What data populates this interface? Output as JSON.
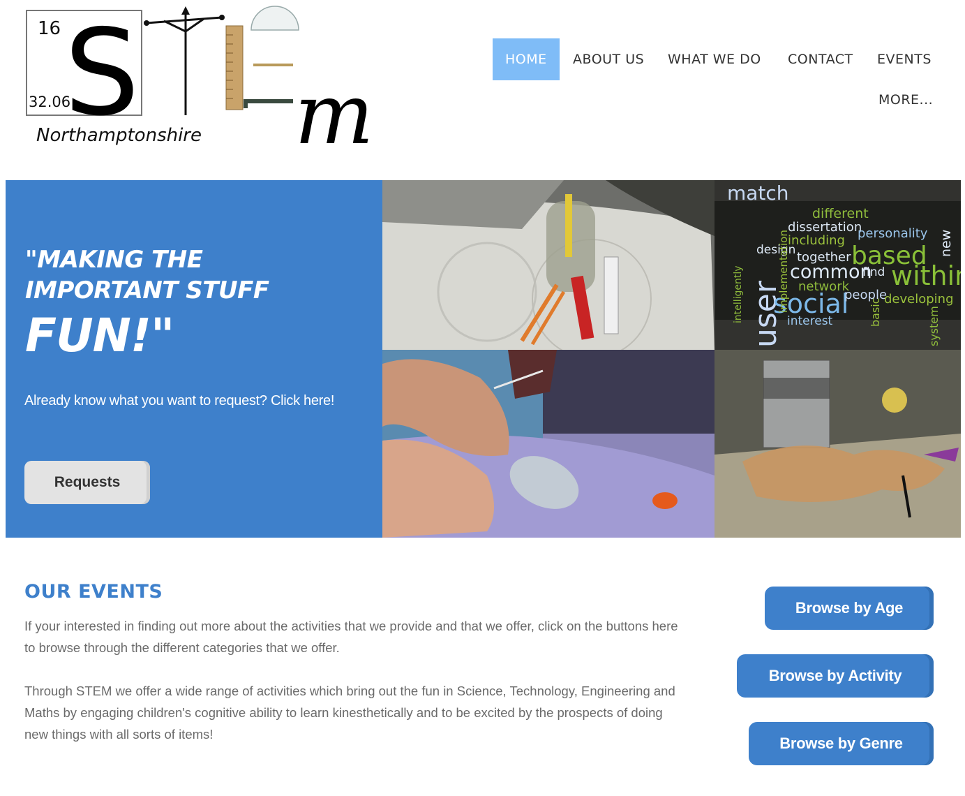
{
  "logo": {
    "atomic_number": "16",
    "symbol": "S",
    "atomic_mass": "32.06",
    "tagline": "Northamptonshire",
    "letter": "m"
  },
  "nav": {
    "items": [
      {
        "label": "HOME",
        "active": true
      },
      {
        "label": "ABOUT US"
      },
      {
        "label": "WHAT WE DO"
      },
      {
        "label": "CONTACT"
      },
      {
        "label": "EVENTS"
      },
      {
        "label": "MORE..."
      }
    ],
    "active_color": "#7fbcf7"
  },
  "hero": {
    "quote_line1": "\"MAKING THE",
    "quote_line2": "IMPORTANT STUFF",
    "quote_big": "FUN!\"",
    "cta_text": "Already know what you want to request? Click here!",
    "button_label": "Requests",
    "bg_color": "#3e80cb",
    "word_cloud": [
      "match",
      "different",
      "dissertation",
      "personality",
      "including",
      "design",
      "together",
      "based",
      "user",
      "common",
      "find",
      "within",
      "network",
      "social",
      "people",
      "developing",
      "interest",
      "basic",
      "system",
      "new",
      "implementation",
      "intelligently"
    ]
  },
  "events": {
    "heading": "OUR EVENTS",
    "paragraph1": "If your interested in finding out more about the activities that we provide and that we offer, click on the buttons here to browse through the different categories that we offer.",
    "paragraph2": "Through STEM we offer a wide range of activities which bring out the fun in Science, Technology, Engineering and Maths by engaging children's cognitive ability to learn kinesthetically and to be excited by the prospects of doing new things with all sorts of items!",
    "buttons": {
      "age": "Browse by Age",
      "activity": "Browse by Activity",
      "genre": "Browse by Genre"
    }
  }
}
